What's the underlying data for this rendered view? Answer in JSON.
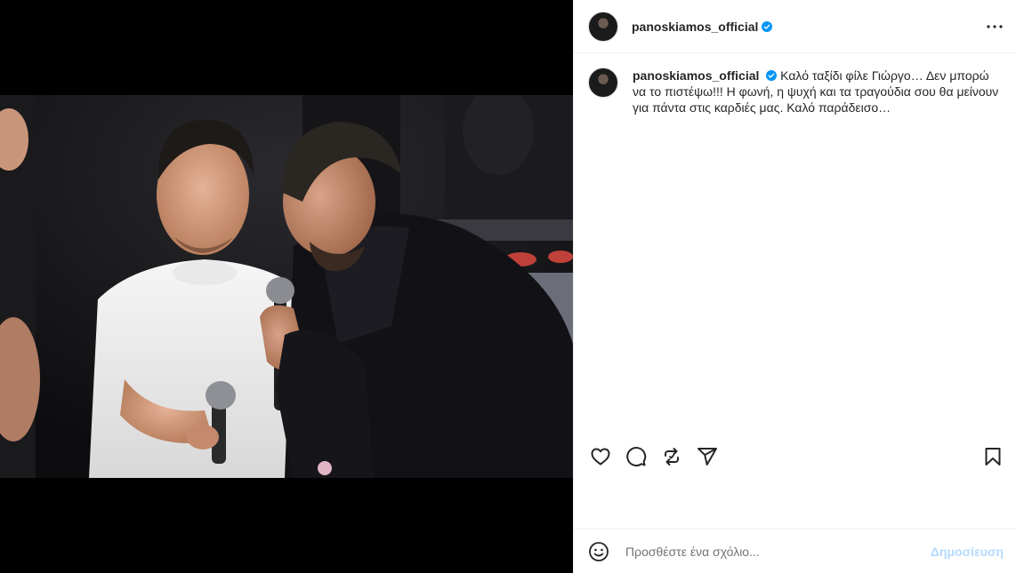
{
  "post": {
    "username": "panoskiamos_official",
    "verified": true,
    "more_icon": "more-horizontal-icon",
    "caption": {
      "username": "panoskiamos_official",
      "text": "Καλό ταξίδι φίλε Γιώργο… Δεν μπορώ να το πιστέψω!!! Η φωνή, η ψυχή και τα τραγούδια σου θα μείνουν για πάντα στις καρδιές μας. Καλό παράδεισο…"
    },
    "actions": {
      "like_icon": "heart-icon",
      "comment_icon": "comment-icon",
      "repost_icon": "repost-icon",
      "share_icon": "send-icon",
      "save_icon": "bookmark-icon"
    },
    "comment_box": {
      "emoji_icon": "emoji-icon",
      "placeholder": "Προσθέστε ένα σχόλιο...",
      "post_label": "Δημοσίευση"
    }
  },
  "colors": {
    "text": "#262626",
    "verified": "#0095f6",
    "post_button": "#b3dbff",
    "border": "#efefef",
    "media_bg": "#000000"
  }
}
